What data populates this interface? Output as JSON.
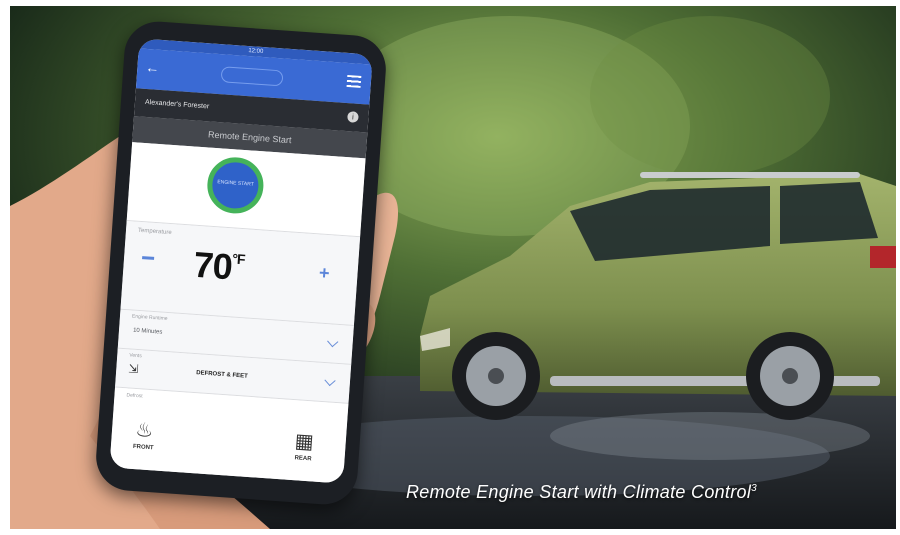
{
  "caption": {
    "text": "Remote Engine Start with Climate Control",
    "superscript": "3"
  },
  "phone_app": {
    "status": "12:00",
    "vehicle_name": "Alexander's Forester",
    "screen_title": "Remote Engine Start",
    "engine_button": "ENGINE START",
    "temperature_label": "Temperature",
    "temperature_value": "70",
    "temperature_unit": "°F",
    "runtime_label": "Engine Runtime",
    "runtime_value": "10 Minutes",
    "vent_label": "Vents",
    "vent_mode": "DEFROST & FEET",
    "defrost_label": "Defrost",
    "front_label": "FRONT",
    "rear_label": "REAR"
  },
  "colors": {
    "app_blue": "#3a6ad4",
    "engine_ring": "#45b35a",
    "car_body": "#7d8f4e"
  },
  "icons": [
    "back-arrow-icon",
    "menu-icon",
    "info-icon",
    "plus-icon",
    "minus-icon",
    "chevron-down-icon",
    "seat-vent-icon",
    "front-defrost-icon",
    "rear-defrost-icon"
  ]
}
